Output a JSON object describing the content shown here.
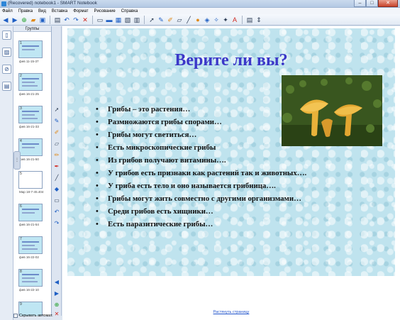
{
  "window": {
    "title": "(Recovered) notebook1 - SMART Notebook",
    "controls": {
      "minimize": "–",
      "maximize": "□",
      "close": "✕"
    }
  },
  "menu": [
    "Файл",
    "Правка",
    "Вид",
    "Вставка",
    "Формат",
    "Рисование",
    "Справка"
  ],
  "toolbar": {
    "icons": [
      "arrow-left-icon",
      "arrow-right-icon",
      "add-page-icon",
      "open-icon",
      "save-icon",
      "paste-icon",
      "undo-icon",
      "redo-icon",
      "delete-icon",
      "screen-shade-icon",
      "display-icon",
      "document-camera-icon",
      "capture-icon",
      "table-icon",
      "select-icon",
      "pen-icon",
      "creative-pen-icon",
      "eraser-icon",
      "line-icon",
      "shape-icon",
      "fill-icon",
      "magic-pen-icon",
      "text-icon",
      "properties-icon",
      "more-icon"
    ]
  },
  "sorter": {
    "header": "Группы",
    "thumbs": [
      {
        "num": "1",
        "label": "фев 11-15-37"
      },
      {
        "num": "2",
        "label": "фев 16-21-25"
      },
      {
        "num": "3",
        "label": "фев 16-21-33"
      },
      {
        "num": "4",
        "label": "фев 16-21-50"
      },
      {
        "num": "5",
        "label": "Мар 18-7-45.404"
      },
      {
        "num": "6",
        "label": "фев 16-21-54"
      },
      {
        "num": "7",
        "label": "фев 16-22-02"
      },
      {
        "num": "8",
        "label": "фев 16-22-10"
      },
      {
        "num": "9",
        "label": ""
      }
    ],
    "autohide_label": "Скрывать автомат."
  },
  "slide": {
    "title": "Верите ли вы?",
    "bullets": [
      "Грибы – это растения…",
      "Размножаются грибы спорами…",
      "Грибы могут светиться…",
      "Есть микроскопические грибы",
      "Из грибов получают витамины….",
      "У грибов есть признаки как растений так и животных….",
      "У гриба есть тело и оно называется грибница….",
      "Грибы могут жить  совместно с другими организмами…",
      "Среди грибов есть хищники…",
      "Есть паразитические грибы…"
    ],
    "photo_subject": "chanterelle mushrooms"
  },
  "canvas": {
    "expand_link": "Растянуть страницу"
  },
  "colors": {
    "title": "#3b37c8",
    "slide_bg": "#bfe3ee",
    "mushroom": "#e9b23a"
  }
}
